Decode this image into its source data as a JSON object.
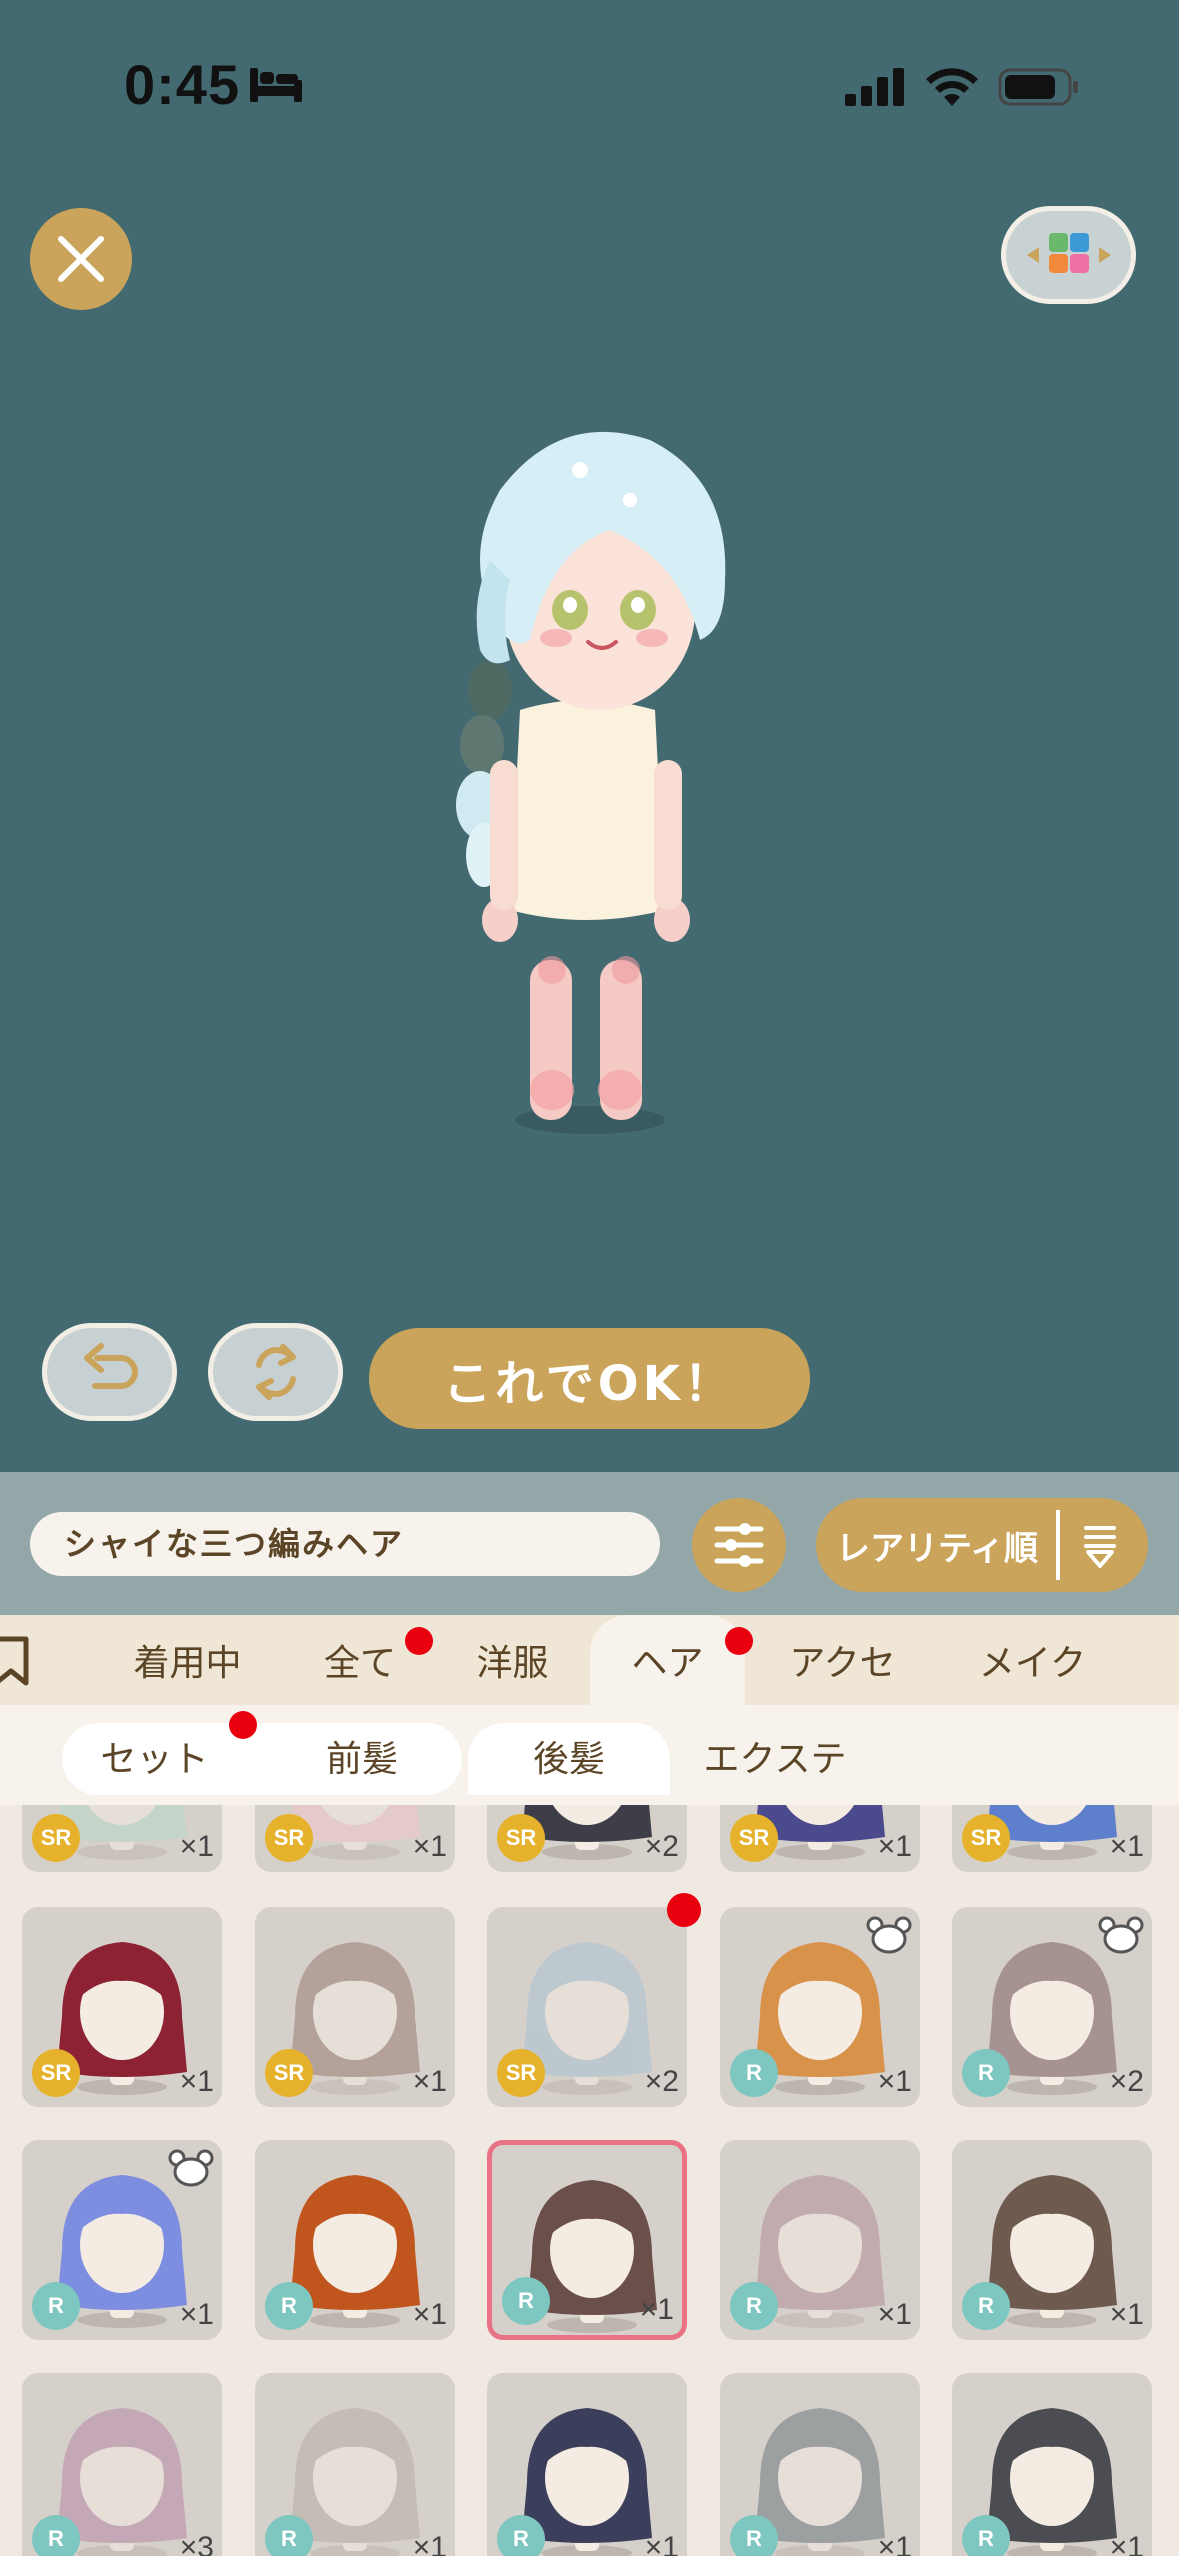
{
  "status": {
    "time": "0:45"
  },
  "preview": {
    "ok_label": "これでOK！"
  },
  "search": {
    "value": "シャイな三つ編みヘア",
    "sort_label": "レアリティ順"
  },
  "tabs": [
    {
      "label": "着用中",
      "badge": false,
      "active": false
    },
    {
      "label": "全て",
      "badge": true,
      "active": false
    },
    {
      "label": "洋服",
      "badge": false,
      "active": false
    },
    {
      "label": "ヘア",
      "badge": true,
      "active": true
    },
    {
      "label": "アクセ",
      "badge": false,
      "active": false
    },
    {
      "label": "メイク",
      "badge": false,
      "active": false
    }
  ],
  "subtabs": [
    {
      "label": "セット",
      "badge": true,
      "active": false
    },
    {
      "label": "前髪",
      "badge": false,
      "active": false
    },
    {
      "label": "後髪",
      "badge": false,
      "active": true
    },
    {
      "label": "エクステ",
      "badge": false,
      "active": false
    }
  ],
  "items": [
    {
      "rarity": "SR",
      "qty": "×1",
      "hair": "#b9d8c9",
      "dot": false,
      "bear": false,
      "selected": false,
      "faded": true
    },
    {
      "rarity": "SR",
      "qty": "×1",
      "hair": "#f1c7c8",
      "dot": false,
      "bear": false,
      "selected": false,
      "faded": true
    },
    {
      "rarity": "SR",
      "qty": "×2",
      "hair": "#3e3e48",
      "dot": false,
      "bear": false,
      "selected": false,
      "faded": false
    },
    {
      "rarity": "SR",
      "qty": "×1",
      "hair": "#4b4a8c",
      "dot": false,
      "bear": false,
      "selected": false,
      "faded": false
    },
    {
      "rarity": "SR",
      "qty": "×1",
      "hair": "#5e7fcb",
      "dot": false,
      "bear": false,
      "selected": false,
      "faded": false
    },
    {
      "rarity": "SR",
      "qty": "×1",
      "hair": "#8c2233",
      "dot": false,
      "bear": false,
      "selected": false,
      "faded": false
    },
    {
      "rarity": "SR",
      "qty": "×1",
      "hair": "#9a7b72",
      "dot": false,
      "bear": false,
      "selected": false,
      "faded": true
    },
    {
      "rarity": "SR",
      "qty": "×2",
      "hair": "#a9c3d3",
      "dot": true,
      "bear": false,
      "selected": false,
      "faded": true
    },
    {
      "rarity": "R",
      "qty": "×1",
      "hair": "#d8924a",
      "dot": false,
      "bear": true,
      "selected": false,
      "faded": false
    },
    {
      "rarity": "R",
      "qty": "×2",
      "hair": "#a69291",
      "dot": false,
      "bear": true,
      "selected": false,
      "faded": false
    },
    {
      "rarity": "R",
      "qty": "×1",
      "hair": "#7d8ee0",
      "dot": false,
      "bear": true,
      "selected": false,
      "faded": false
    },
    {
      "rarity": "R",
      "qty": "×1",
      "hair": "#c0561e",
      "dot": false,
      "bear": false,
      "selected": false,
      "faded": false
    },
    {
      "rarity": "R",
      "qty": "×1",
      "hair": "#6a4f4a",
      "dot": false,
      "bear": false,
      "selected": true,
      "faded": false
    },
    {
      "rarity": "R",
      "qty": "×1",
      "hair": "#b38d99",
      "dot": false,
      "bear": false,
      "selected": false,
      "faded": true
    },
    {
      "rarity": "R",
      "qty": "×1",
      "hair": "#6e5a4e",
      "dot": false,
      "bear": false,
      "selected": false,
      "faded": false
    },
    {
      "rarity": "R",
      "qty": "×3",
      "hair": "#b689a7",
      "dot": false,
      "bear": false,
      "selected": false,
      "faded": true
    },
    {
      "rarity": "R",
      "qty": "×1",
      "hair": "#b8aea4",
      "dot": false,
      "bear": false,
      "selected": false,
      "faded": true
    },
    {
      "rarity": "R",
      "qty": "×1",
      "hair": "#3b3f5c",
      "dot": false,
      "bear": false,
      "selected": false,
      "faded": false
    },
    {
      "rarity": "R",
      "qty": "×1",
      "hair": "#6f7a80",
      "dot": false,
      "bear": false,
      "selected": false,
      "faded": true
    },
    {
      "rarity": "R",
      "qty": "×1",
      "hair": "#4c4d52",
      "dot": false,
      "bear": false,
      "selected": false,
      "faded": false
    }
  ]
}
